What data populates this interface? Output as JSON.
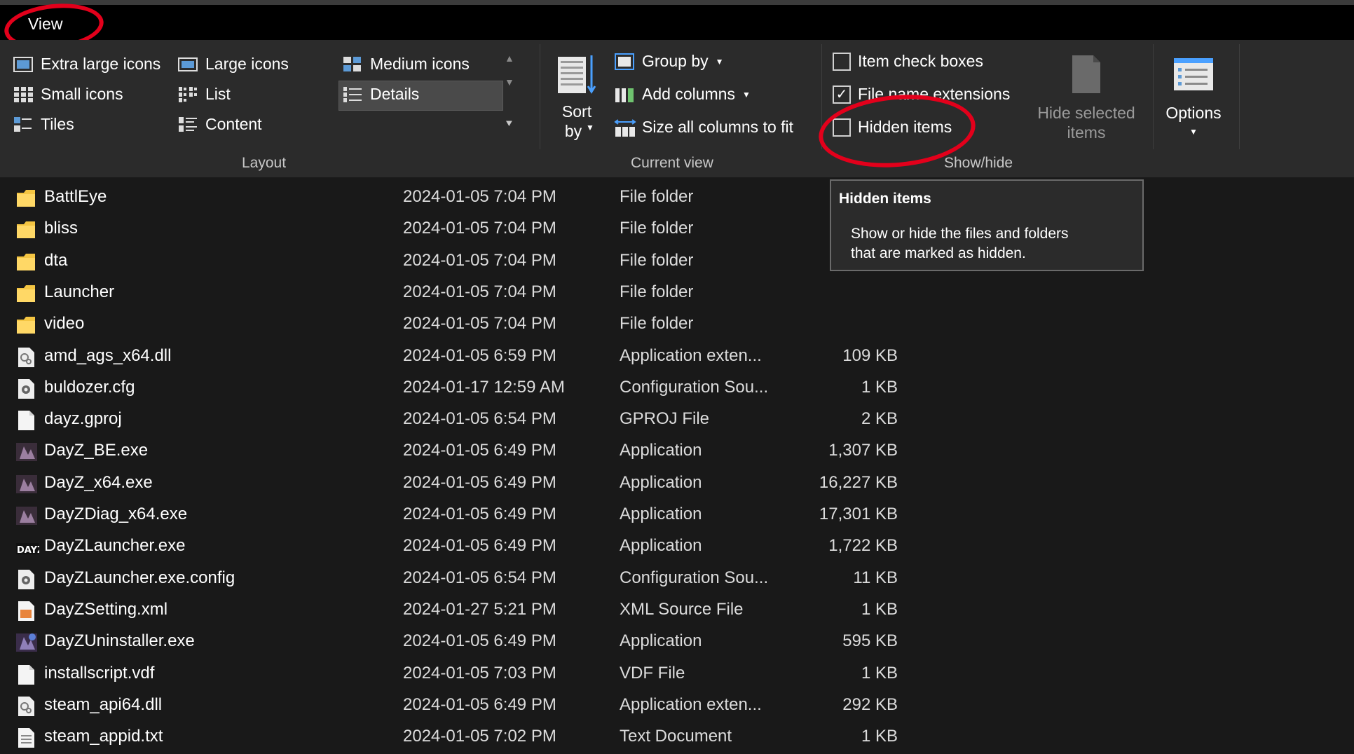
{
  "tab": {
    "view_label": "View"
  },
  "ribbon": {
    "layout": {
      "items": [
        "Extra large icons",
        "Large icons",
        "Medium icons",
        "Small icons",
        "List",
        "Details",
        "Tiles",
        "Content"
      ],
      "selected": "Details",
      "group_label": "Layout"
    },
    "current_view": {
      "sort_by_line1": "Sort",
      "sort_by_line2": "by",
      "group_by": "Group by",
      "add_columns": "Add columns",
      "size_columns": "Size all columns to fit",
      "group_label": "Current view"
    },
    "show_hide": {
      "item_check_boxes": "Item check boxes",
      "item_check_boxes_checked": false,
      "file_name_extensions": "File name extensions",
      "file_name_extensions_checked": true,
      "hidden_items": "Hidden items",
      "hidden_items_checked": false,
      "hide_selected_line1": "Hide selected",
      "hide_selected_line2": "items",
      "group_label": "Show/hide"
    },
    "options": {
      "label": "Options"
    }
  },
  "tooltip": {
    "title": "Hidden items",
    "line1": "Show or hide the files and folders",
    "line2": "that are marked as hidden."
  },
  "files": [
    {
      "name": "BattlEye",
      "date": "2024-01-05 7:04 PM",
      "type": "File folder",
      "size": "",
      "icon": "folder-icon"
    },
    {
      "name": "bliss",
      "date": "2024-01-05 7:04 PM",
      "type": "File folder",
      "size": "",
      "icon": "folder-icon"
    },
    {
      "name": "dta",
      "date": "2024-01-05 7:04 PM",
      "type": "File folder",
      "size": "",
      "icon": "folder-icon"
    },
    {
      "name": "Launcher",
      "date": "2024-01-05 7:04 PM",
      "type": "File folder",
      "size": "",
      "icon": "folder-icon"
    },
    {
      "name": "video",
      "date": "2024-01-05 7:04 PM",
      "type": "File folder",
      "size": "",
      "icon": "folder-icon"
    },
    {
      "name": "amd_ags_x64.dll",
      "date": "2024-01-05 6:59 PM",
      "type": "Application exten...",
      "size": "109 KB",
      "icon": "dll-icon"
    },
    {
      "name": "buldozer.cfg",
      "date": "2024-01-17 12:59 AM",
      "type": "Configuration Sou...",
      "size": "1 KB",
      "icon": "config-icon"
    },
    {
      "name": "dayz.gproj",
      "date": "2024-01-05 6:54 PM",
      "type": "GPROJ File",
      "size": "2 KB",
      "icon": "blank-file-icon"
    },
    {
      "name": "DayZ_BE.exe",
      "date": "2024-01-05 6:49 PM",
      "type": "Application",
      "size": "1,307 KB",
      "icon": "dayz-app-icon"
    },
    {
      "name": "DayZ_x64.exe",
      "date": "2024-01-05 6:49 PM",
      "type": "Application",
      "size": "16,227 KB",
      "icon": "dayz-app-icon"
    },
    {
      "name": "DayZDiag_x64.exe",
      "date": "2024-01-05 6:49 PM",
      "type": "Application",
      "size": "17,301 KB",
      "icon": "dayz-app-icon"
    },
    {
      "name": "DayZLauncher.exe",
      "date": "2024-01-05 6:49 PM",
      "type": "Application",
      "size": "1,722 KB",
      "icon": "dayz-launcher-icon"
    },
    {
      "name": "DayZLauncher.exe.config",
      "date": "2024-01-05 6:54 PM",
      "type": "Configuration Sou...",
      "size": "11 KB",
      "icon": "config-icon"
    },
    {
      "name": "DayZSetting.xml",
      "date": "2024-01-27 5:21 PM",
      "type": "XML Source File",
      "size": "1 KB",
      "icon": "xml-icon"
    },
    {
      "name": "DayZUninstaller.exe",
      "date": "2024-01-05 6:49 PM",
      "type": "Application",
      "size": "595 KB",
      "icon": "uninstaller-icon"
    },
    {
      "name": "installscript.vdf",
      "date": "2024-01-05 7:03 PM",
      "type": "VDF File",
      "size": "1 KB",
      "icon": "blank-file-icon"
    },
    {
      "name": "steam_api64.dll",
      "date": "2024-01-05 6:49 PM",
      "type": "Application exten...",
      "size": "292 KB",
      "icon": "dll-icon"
    },
    {
      "name": "steam_appid.txt",
      "date": "2024-01-05 7:02 PM",
      "type": "Text Document",
      "size": "1 KB",
      "icon": "text-file-icon"
    }
  ],
  "colors": {
    "background": "#191919",
    "ribbon": "#2b2b2b",
    "annotation": "#e3001b",
    "folder": "#f4c542"
  }
}
